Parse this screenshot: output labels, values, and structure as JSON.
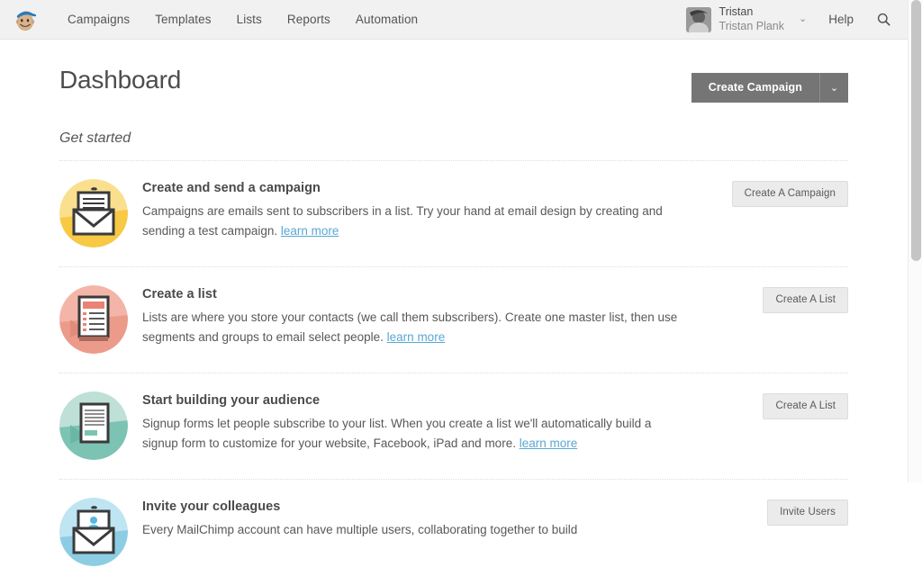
{
  "topnav": {
    "logo_name": "mailchimp-freddie-logo",
    "links": [
      {
        "label": "Campaigns",
        "name": "nav-link-campaigns"
      },
      {
        "label": "Templates",
        "name": "nav-link-templates"
      },
      {
        "label": "Lists",
        "name": "nav-link-lists"
      },
      {
        "label": "Reports",
        "name": "nav-link-reports"
      },
      {
        "label": "Automation",
        "name": "nav-link-automation"
      }
    ],
    "user": {
      "username": "Tristan",
      "fullname": "Tristan Plank",
      "caret": "⌄"
    },
    "help_label": "Help",
    "search_icon": "search-icon"
  },
  "page": {
    "title": "Dashboard",
    "section_label": "Get started",
    "create_campaign": {
      "label": "Create Campaign",
      "caret": "⌄"
    }
  },
  "get_started": [
    {
      "icon": "envelope-letter-icon",
      "icon_color": "#f5ca4d",
      "title": "Create and send a campaign",
      "desc_before": "Campaigns are emails sent to subscribers in a list. Try your hand at email design by creating and sending a test campaign. ",
      "link": "learn more",
      "desc_after": "",
      "button": "Create A Campaign"
    },
    {
      "icon": "list-document-icon",
      "icon_color": "#ef9a8b",
      "title": "Create a list",
      "desc_before": "Lists are where you store your contacts (we call them subscribers). Create one master list, then use segments and groups to email select people. ",
      "link": "learn more",
      "desc_after": "",
      "button": "Create A List"
    },
    {
      "icon": "signup-form-icon",
      "icon_color": "#7cc3b4",
      "title": "Start building your audience",
      "desc_before": "Signup forms let people subscribe to your list. When you create a list we'll automatically build a signup form to customize for your website, Facebook, iPad and more. ",
      "link": "learn more",
      "desc_after": "",
      "button": "Create A List"
    },
    {
      "icon": "envelope-user-icon",
      "icon_color": "#9fd6e8",
      "title": "Invite your colleagues",
      "desc_before": "Every MailChimp account can have multiple users, collaborating together to build",
      "link": "",
      "desc_after": "",
      "button": "Invite Users"
    }
  ],
  "scrollbar": {
    "name": "vertical-scrollbar"
  }
}
